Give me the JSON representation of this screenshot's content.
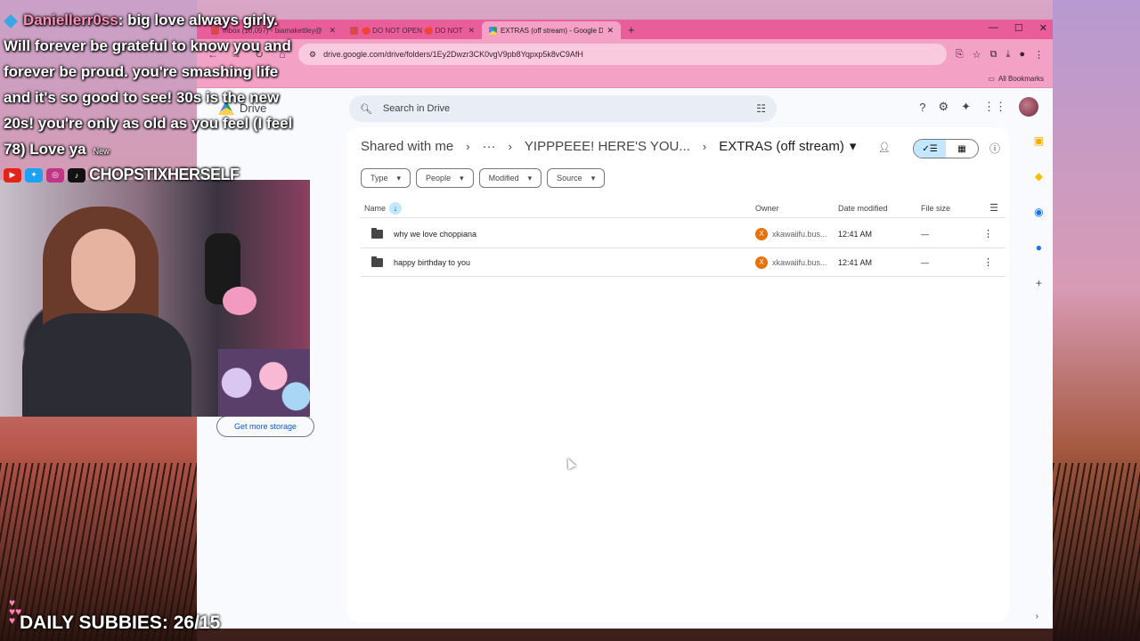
{
  "browser": {
    "tabs": [
      {
        "title": "Inbox (10,097) - biamakettley@",
        "active": false
      },
      {
        "title": "🛑 DO NOT OPEN 🛑 DO NOT",
        "active": false
      },
      {
        "title": "EXTRAS (off stream) - Google D",
        "active": true
      }
    ],
    "url": "drive.google.com/drive/folders/1Ey2Dwzr3CK0vgV9pb8Yqpxp5k8vC9AfH",
    "all_bookmarks": "All Bookmarks"
  },
  "drive": {
    "logo_label": "Drive",
    "search_placeholder": "Search in Drive",
    "breadcrumb": {
      "root": "Shared with me",
      "ellipsis": "···",
      "parent": "YIPPPEEE! HERE'S YOU...",
      "current": "EXTRAS (off stream)"
    },
    "filters": [
      "Type",
      "People",
      "Modified",
      "Source"
    ],
    "columns": {
      "name": "Name",
      "owner": "Owner",
      "date": "Date modified",
      "size": "File size"
    },
    "rows": [
      {
        "name": "why we love choppiana",
        "owner_initial": "X",
        "owner": "xkawaiifu.bus...",
        "date": "12:41 AM",
        "size": "—"
      },
      {
        "name": "happy birthday to you",
        "owner_initial": "X",
        "owner": "xkawaiifu.bus...",
        "date": "12:41 AM",
        "size": "—"
      }
    ],
    "storage_button": "Get more storage"
  },
  "overlay": {
    "chat_user": "Daniellerr0ss",
    "chat_message": ": big love always girly. Will forever be grateful to know you and forever be proud. you're smashing life and it's so good to see! 30s is the new 20s! you're only as old as you feel (I feel 78) Love ya",
    "chat_new": "New",
    "handle": "CHOPSTIXHERSELF",
    "subbies": "DAILY SUBBIES: 26/15"
  }
}
